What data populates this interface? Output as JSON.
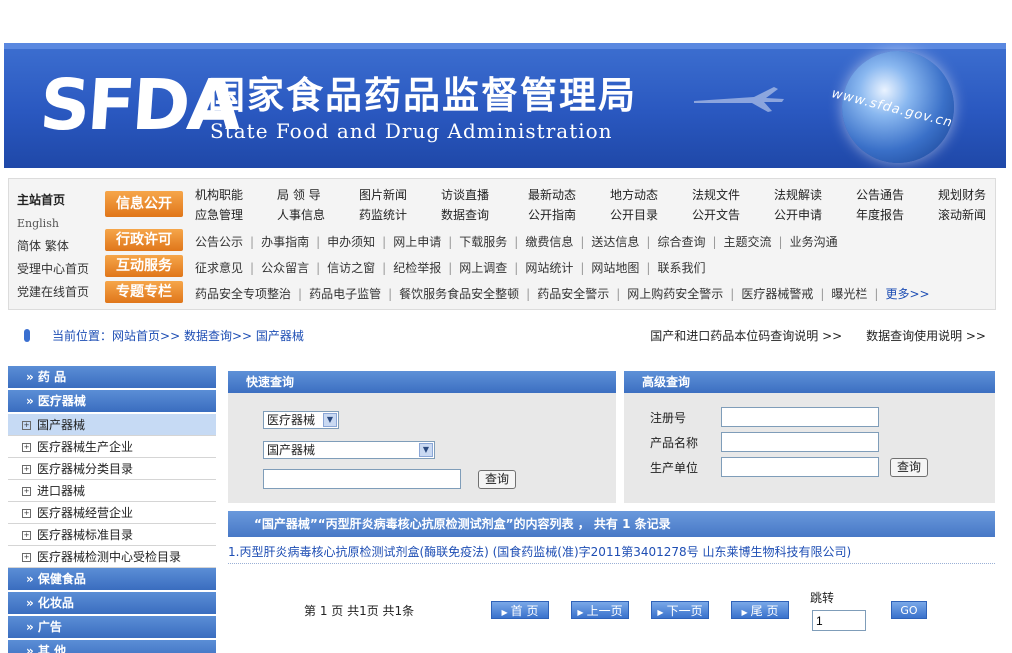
{
  "banner": {
    "logo_mark": "SFDA",
    "title_cn": "国家食品药品监督管理局",
    "title_en": "State Food and Drug Administration",
    "site_url": "www.sfda.gov.cn"
  },
  "nav": {
    "left_links": [
      "主站首页",
      "English",
      "简体 繁体",
      "受理中心首页",
      "党建在线首页"
    ],
    "badges": [
      "信息公开",
      "行政许可",
      "互动服务",
      "专题专栏"
    ],
    "columns": [
      [
        "机构职能",
        "应急管理"
      ],
      [
        "局 领 导",
        "人事信息"
      ],
      [
        "图片新闻",
        "药监统计"
      ],
      [
        "访谈直播",
        "数据查询"
      ],
      [
        "最新动态",
        "公开指南"
      ],
      [
        "地方动态",
        "公开目录"
      ],
      [
        "法规文件",
        "公开文告"
      ],
      [
        "法规解读",
        "公开申请"
      ],
      [
        "公告通告",
        "年度报告"
      ],
      [
        "规划财务",
        "滚动新闻"
      ]
    ],
    "row_admin": [
      "公告公示",
      "办事指南",
      "申办须知",
      "网上申请",
      "下载服务",
      "缴费信息",
      "送达信息",
      "综合查询",
      "主题交流",
      "业务沟通"
    ],
    "row_interact": [
      "征求意见",
      "公众留言",
      "信访之窗",
      "纪检举报",
      "网上调查",
      "网站统计",
      "网站地图",
      "联系我们"
    ],
    "row_special": [
      "药品安全专项整治",
      "药品电子监管",
      "餐饮服务食品安全整顿",
      "药品安全警示",
      "网上购药安全警示",
      "医疗器械警戒",
      "曝光栏"
    ],
    "more": "更多>>"
  },
  "breadcrumb": {
    "label": "当前位置：",
    "path": "网站首页>> 数据查询>> 国产器械",
    "links": [
      "国产和进口药品本位码查询说明 >>",
      "数据查询使用说明 >>"
    ]
  },
  "sidebar": {
    "drugs": "» 药 品",
    "devices": "» 医疗器械",
    "device_items": [
      "国产器械",
      "医疗器械生产企业",
      "医疗器械分类目录",
      "进口器械",
      "医疗器械经营企业",
      "医疗器械标准目录",
      "医疗器械检测中心受检目录"
    ],
    "health_food": "» 保健食品",
    "cosmetics": "» 化妆品",
    "ads": "» 广告",
    "other": "» 其 他"
  },
  "quick_search": {
    "title": "快速查询",
    "category_value": "医疗器械",
    "subcategory_value": "国产器械",
    "keyword_value": "",
    "submit": "查询"
  },
  "advanced_search": {
    "title": "高级查询",
    "reg_no_label": "注册号",
    "product_label": "产品名称",
    "maker_label": "生产单位",
    "submit": "查询"
  },
  "result": {
    "header": "“国产器械”“丙型肝炎病毒核心抗原检测试剂盒”的内容列表 ， 共有 1 条记录",
    "items": [
      "1.丙型肝炎病毒核心抗原检测试剂盒(酶联免疫法) (国食药监械(准)字2011第3401278号 山东莱博生物科技有限公司)"
    ]
  },
  "pager": {
    "info": "第 1 页 共1页 共1条",
    "first": "首 页",
    "prev": "上一页",
    "next": "下一页",
    "last": "尾 页",
    "jump_label": "跳转",
    "jump_value": "1",
    "go": "GO"
  }
}
